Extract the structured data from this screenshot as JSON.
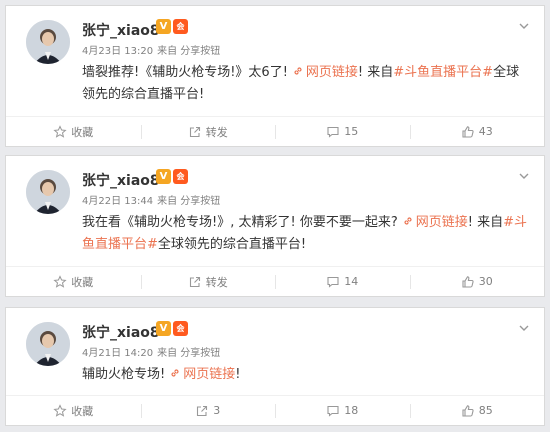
{
  "posts": [
    {
      "author": "张宁_xiao8",
      "verified_badge": "V",
      "vip_badge": "会",
      "date": "4月23日 13:20",
      "source": "来自 分享按钮",
      "text_before": "墙裂推荐!《辅助火枪专场!》太6了!",
      "link_label": "网页链接",
      "text_middle": "! 来自",
      "hashtag": "#斗鱼直播平台#",
      "text_after": "全球领先的综合直播平台!",
      "actions": {
        "favorite": "收藏",
        "repost": "转发",
        "comment": "15",
        "like": "43"
      }
    },
    {
      "author": "张宁_xiao8",
      "verified_badge": "V",
      "vip_badge": "会",
      "date": "4月22日 13:44",
      "source": "来自 分享按钮",
      "text_before": "我在看《辅助火枪专场!》, 太精彩了! 你要不要一起来?",
      "link_label": "网页链接",
      "text_middle": "! 来自",
      "hashtag": "#斗鱼直播平台#",
      "text_after": "全球领先的综合直播平台!",
      "actions": {
        "favorite": "收藏",
        "repost": "转发",
        "comment": "14",
        "like": "30"
      }
    },
    {
      "author": "张宁_xiao8",
      "verified_badge": "V",
      "vip_badge": "会",
      "date": "4月21日 14:20",
      "source": "来自 分享按钮",
      "text_before": "辅助火枪专场!",
      "link_label": "网页链接",
      "text_after": "!",
      "actions": {
        "favorite": "收藏",
        "repost": "3",
        "comment": "18",
        "like": "85"
      }
    }
  ],
  "colors": {
    "link": "#eb7350",
    "verified": "#f5a623",
    "vip": "#ff5a1f",
    "meta": "#808080"
  },
  "icons": [
    "more-chevron-icon",
    "link-icon",
    "star-icon",
    "repost-icon",
    "comment-icon",
    "thumbs-up-icon"
  ]
}
